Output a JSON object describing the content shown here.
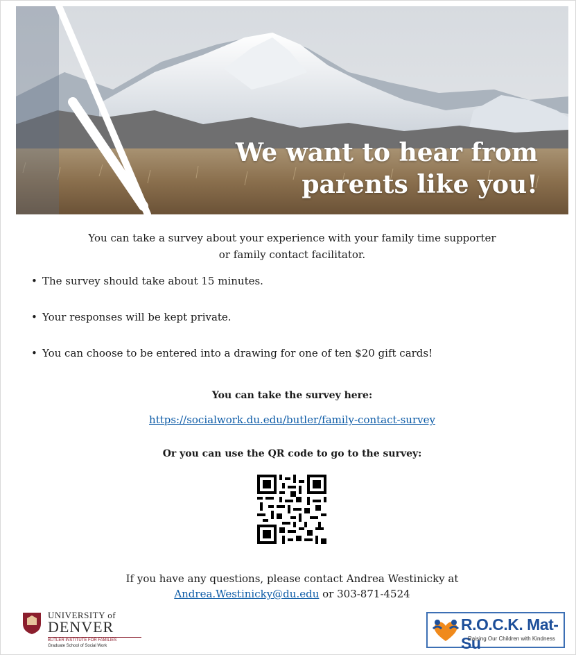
{
  "banner": {
    "title_line1": "We want to hear from",
    "title_line2": "parents like you!"
  },
  "intro": {
    "line1": "You can take a survey about your experience with your family time supporter",
    "line2": "or family contact facilitator."
  },
  "bullets": [
    "The survey should take about 15 minutes.",
    "Your responses will be kept private.",
    "You can choose to be entered into a drawing for one of ten $20 gift cards!"
  ],
  "bullet_symbol": "•",
  "survey": {
    "heading": "You can take the survey here:",
    "link": "https://socialwork.du.edu/butler/family-contact-survey",
    "qr_heading": "Or you can use the QR code to go to the survey:"
  },
  "contact": {
    "line1": "If you have any questions, please contact Andrea Westinicky at",
    "email": "Andrea.Westinicky@du.edu",
    "phone_text": "or 303-871-4524"
  },
  "logos": {
    "du_line1": "UNIVERSITY of",
    "du_line2": "DENVER",
    "du_sub1": "BUTLER INSTITUTE FOR FAMILIES",
    "du_sub2": "Graduate School of Social Work",
    "rock_name": "R.O.C.K. Mat-Su",
    "rock_tagline": "Raising Our Children with Kindness"
  },
  "colors": {
    "link": "#0b5aa6",
    "du_red": "#8b1e2d",
    "rock_blue": "#1d4f9a",
    "rock_orange": "#f08a1c"
  }
}
